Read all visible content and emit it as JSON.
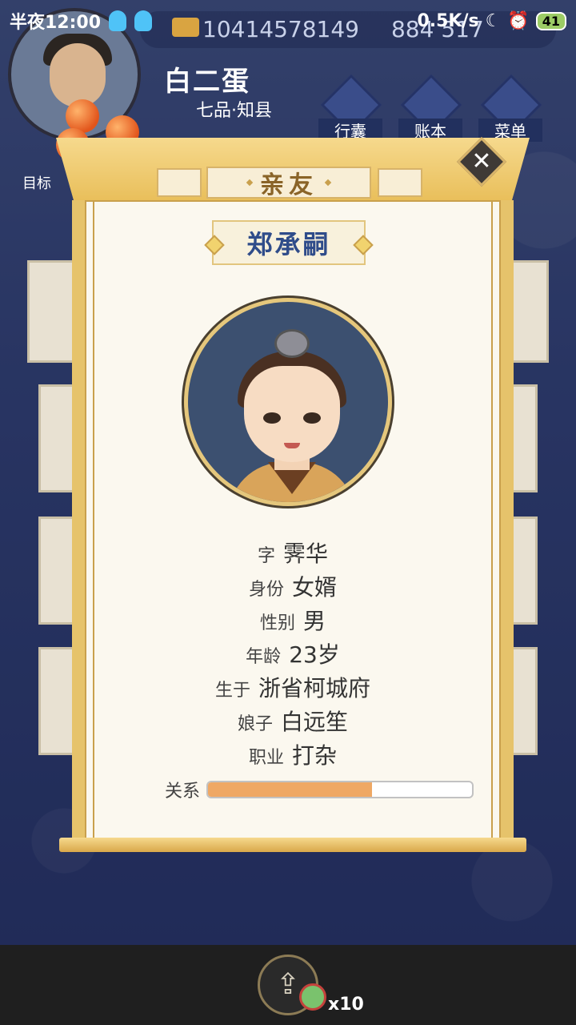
{
  "status_bar": {
    "time": "半夜12:00",
    "net_speed": "0.5K/s",
    "battery": "41"
  },
  "header": {
    "currency_1": "10414578149",
    "currency_2": "884 517",
    "player_name": "白二蛋",
    "player_rank": "七品·知县",
    "buttons": [
      {
        "label": "行囊"
      },
      {
        "label": "账本"
      },
      {
        "label": "菜单"
      }
    ],
    "target_label": "目标"
  },
  "modal": {
    "title": "亲友",
    "close_glyph": "✕",
    "character_name": "郑承嗣",
    "details": [
      {
        "key": "字",
        "value": "霁华"
      },
      {
        "key": "身份",
        "value": "女婿"
      },
      {
        "key": "性别",
        "value": "男"
      },
      {
        "key": "年龄",
        "value": "23岁"
      },
      {
        "key": "生于",
        "value": "浙省柯城府"
      },
      {
        "key": "娘子",
        "value": "白远笙"
      },
      {
        "key": "职业",
        "value": "打杂"
      }
    ],
    "relation_label": "关系",
    "relation_level": 0.62
  },
  "bottom": {
    "share_glyph": "⇪",
    "item_count": "x10"
  },
  "colors": {
    "relation_fill": "#efa864",
    "name_color": "#2f4c8a",
    "gold_frame": "#e6c36b"
  }
}
